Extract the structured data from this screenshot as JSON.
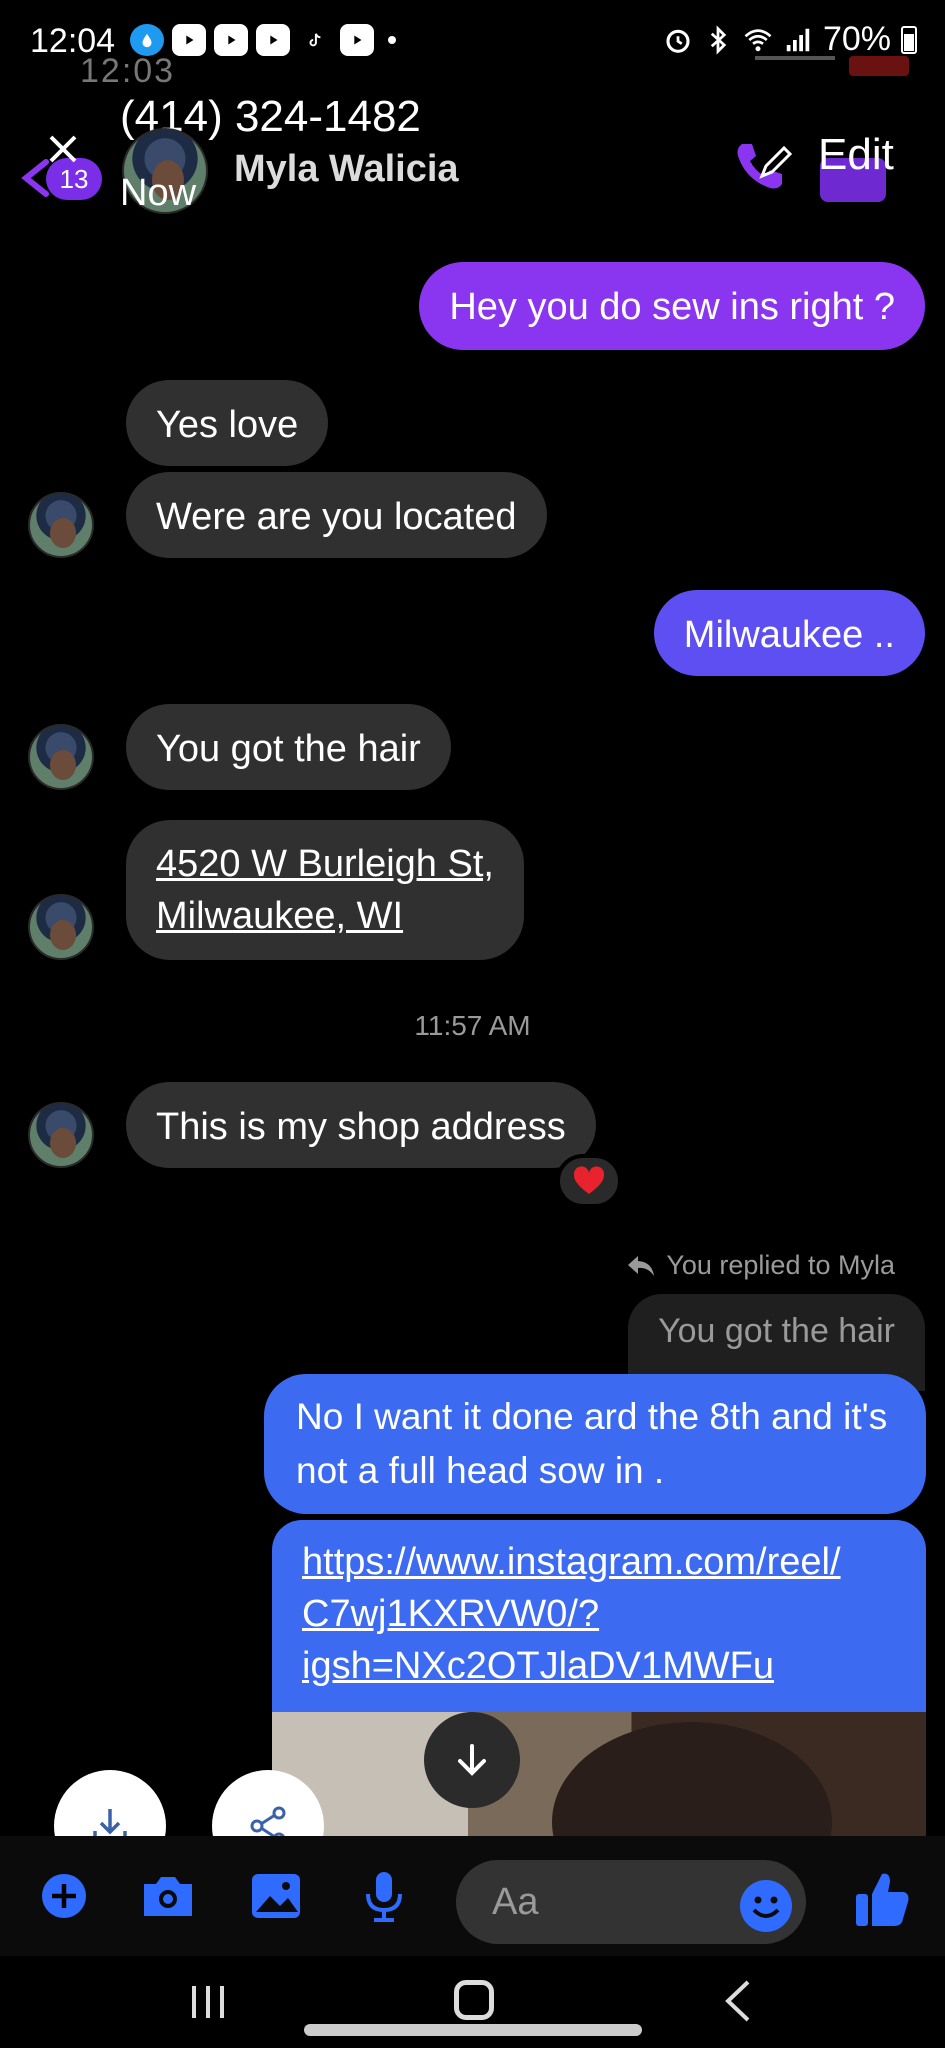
{
  "status_bar": {
    "time": "12:04",
    "battery": "70%",
    "icons": [
      "water-drop-icon",
      "youtube-icon",
      "youtube-icon",
      "youtube-icon",
      "tiktok-icon",
      "youtube-icon",
      "alarm-icon",
      "bluetooth-icon",
      "wifi-icon",
      "signal-icon",
      "battery-icon"
    ]
  },
  "overlay": {
    "ghost_time": "12:03"
  },
  "header": {
    "phone_number": "(414) 324-1482",
    "presence": "Now",
    "contact_name": "Myla Walicia",
    "unread_count": "13",
    "edit_label": "Edit"
  },
  "messages": [
    {
      "id": "m1",
      "direction": "out",
      "text": "Hey you do sew ins right ?"
    },
    {
      "id": "m2",
      "direction": "in",
      "text": "Yes love"
    },
    {
      "id": "m3",
      "direction": "in",
      "text": "Were are you located"
    },
    {
      "id": "m4",
      "direction": "out",
      "text": "Milwaukee .."
    },
    {
      "id": "m5",
      "direction": "in",
      "text": "You got the hair"
    },
    {
      "id": "m6",
      "direction": "in",
      "text_line1": "4520 W Burleigh St,",
      "text_line2": "Milwaukee, WI"
    },
    {
      "id": "m7",
      "direction": "in",
      "text": "This is my shop address",
      "reaction": "heart"
    },
    {
      "id": "m8",
      "direction": "out",
      "reply_label": "You replied to Myla",
      "quoted": "You got the hair",
      "text": "No I want it done ard the 8th and it's not a full head sow in ."
    },
    {
      "id": "m9",
      "direction": "out",
      "link_line1": "https://www.instagram.com/reel/",
      "link_line2": "C7wj1KXRVW0/?",
      "link_line3": "igsh=NXc2OTJlaDV1MWFu"
    }
  ],
  "timestamp": "11:57 AM",
  "composer": {
    "placeholder": "Aa"
  },
  "colors": {
    "accent_purple": "#8a36f0",
    "bubble_blue": "#3c6bf2",
    "bubble_incoming": "#303030",
    "icon_blue": "#2f6bff"
  }
}
